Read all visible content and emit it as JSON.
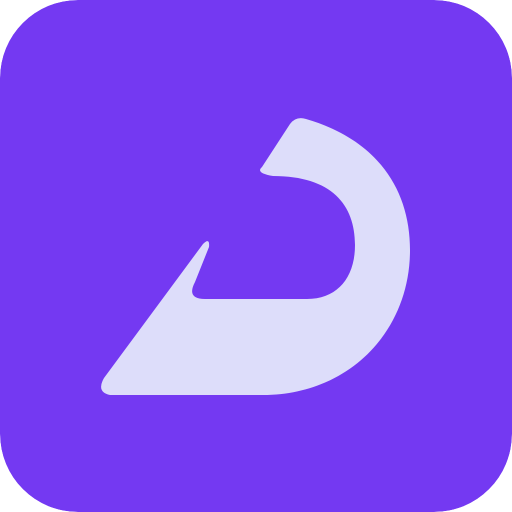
{
  "icon": {
    "name": "app-logo",
    "symbol": "stylized-letter-d-logo-icon",
    "colors": {
      "background": "#7439F2",
      "glyph": "#DDDDFA"
    }
  }
}
